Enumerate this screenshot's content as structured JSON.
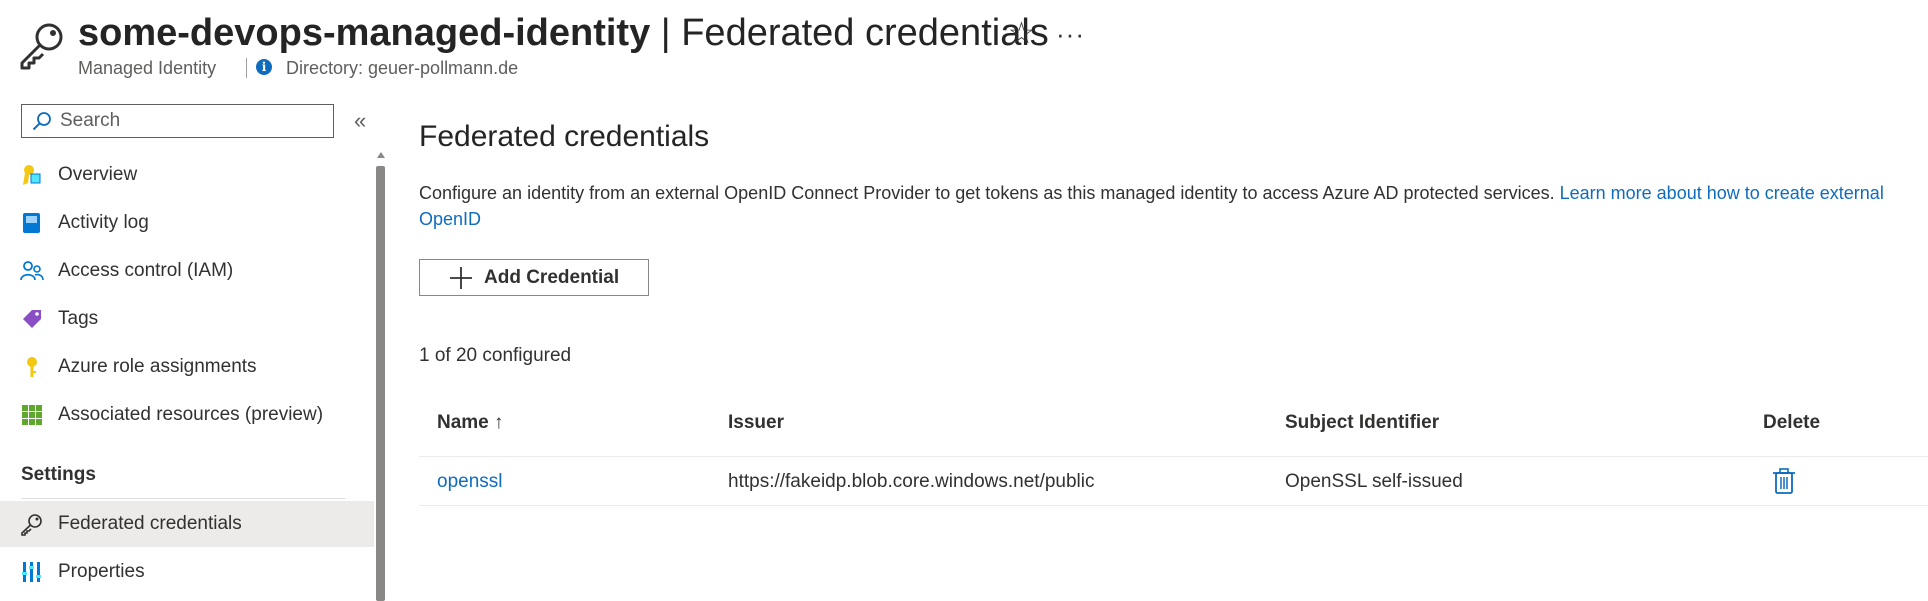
{
  "header": {
    "resource_name": "some-devops-managed-identity",
    "separator": "|",
    "page_name": "Federated credentials",
    "star_glyph": "☆",
    "more_glyph": "···",
    "subtitle": "Managed Identity",
    "directory": "Directory: geuer-pollmann.de",
    "icon": "key-icon"
  },
  "sidebar": {
    "search_placeholder": "Search",
    "collapse_glyph": "«",
    "items": [
      {
        "label": "Overview",
        "icon": "overview-icon"
      },
      {
        "label": "Activity log",
        "icon": "activity-log-icon"
      },
      {
        "label": "Access control (IAM)",
        "icon": "people-icon"
      },
      {
        "label": "Tags",
        "icon": "tag-icon"
      },
      {
        "label": "Azure role assignments",
        "icon": "key-gold-icon"
      },
      {
        "label": "Associated resources (preview)",
        "icon": "grid-icon"
      }
    ],
    "settings_header": "Settings",
    "settings_items": [
      {
        "label": "Federated credentials",
        "icon": "key-icon",
        "selected": true
      },
      {
        "label": "Properties",
        "icon": "properties-icon"
      }
    ]
  },
  "main": {
    "title": "Federated credentials",
    "description": "Configure an identity from an external OpenID Connect Provider to get tokens as this managed identity to access Azure AD protected services.",
    "learn_more": "Learn more about how to create external OpenID",
    "add_button": "Add Credential",
    "count": "1 of 20 configured",
    "table": {
      "headers": {
        "name": "Name",
        "sort": "↑",
        "issuer": "Issuer",
        "subject": "Subject Identifier",
        "delete": "Delete"
      },
      "rows": [
        {
          "name": "openssl",
          "issuer": "https://fakeidp.blob.core.windows.net/public",
          "subject": "OpenSSL self-issued"
        }
      ]
    }
  },
  "colors": {
    "accent": "#0f6cbd",
    "selected_bg": "#edebe9",
    "text": "#323130"
  }
}
